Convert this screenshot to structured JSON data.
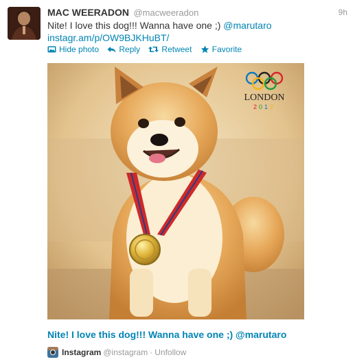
{
  "tweet": {
    "fullname": "MAC WEERADON",
    "username": "@macweeradon",
    "time": "9h",
    "text_main": "Nite! I love this dog!!! Wanna have one ;) ",
    "mention": "@marutaro",
    "link": "instagr.am/p/OW9BJKHuBT/",
    "avatar_icon": "user-avatar-photo"
  },
  "actions": {
    "hide_photo": "Hide photo",
    "reply": "Reply",
    "retweet": "Retweet",
    "favorite": "Favorite",
    "icons": {
      "hide_photo": "photo-icon",
      "reply": "reply-arrow-icon",
      "retweet": "retweet-icon",
      "favorite": "star-icon"
    },
    "color": "#0084b4"
  },
  "media": {
    "description_icon": "shiba-inu-with-gold-medal-photo",
    "overlay_text": "LONDON",
    "overlay_year": "2012"
  },
  "caption": "Nite! I love this dog!!! Wanna have one ;) @marutaro",
  "source": {
    "name": "Instagram",
    "handle": "@instagram",
    "separator": "·",
    "action": "Unfollow",
    "icon": "instagram-icon"
  }
}
